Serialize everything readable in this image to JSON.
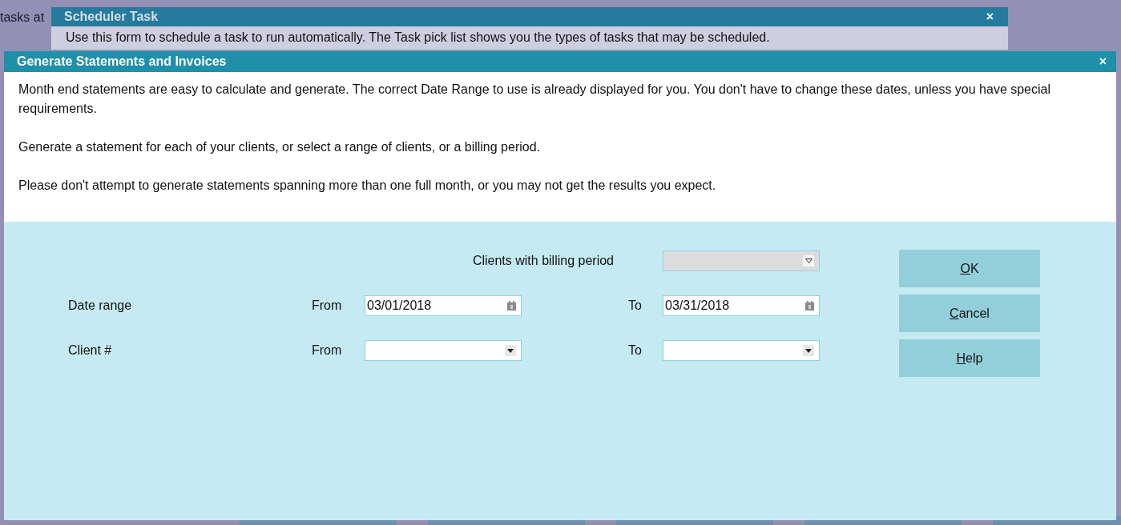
{
  "background": {
    "lines": [
      "tasks at"
    ]
  },
  "scheduler_window": {
    "title": "Scheduler Task",
    "close": "×",
    "description": "Use this form to schedule a task to run automatically. The Task pick list shows you the types of tasks that may be scheduled."
  },
  "dialog": {
    "title": "Generate Statements and Invoices",
    "close": "×",
    "paragraphs": [
      "Month end statements are easy to calculate and generate. The correct Date Range to use is already displayed for you. You don't have to change these dates, unless you have special requirements.",
      "Generate a statement for each of your clients, or select a range of clients, or a billing period.",
      "Please don't attempt to generate statements spanning more than one full month, or you may not get the results you expect."
    ],
    "billing_period": {
      "label": "Clients with billing period",
      "disabled": true
    },
    "rows": [
      {
        "label": "Date range",
        "from_label": "From",
        "from": {
          "kind": "date",
          "value": "03/01/2018"
        },
        "to_label": "To",
        "to": {
          "kind": "date",
          "value": "03/31/2018"
        }
      },
      {
        "label": "Client #",
        "from_label": "From",
        "from": {
          "kind": "dropdown"
        },
        "to_label": "To",
        "to": {
          "kind": "dropdown"
        }
      }
    ],
    "buttons": [
      "OK",
      "Cancel",
      "Help"
    ]
  }
}
